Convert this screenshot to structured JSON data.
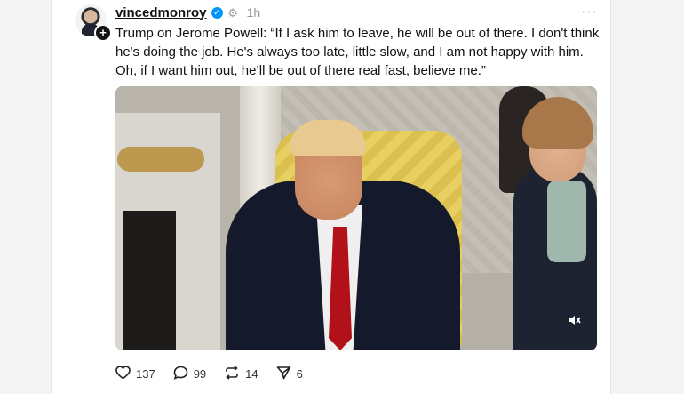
{
  "post": {
    "username": "vincedmonroy",
    "timestamp": "1h",
    "text": "Trump on Jerome Powell⁠⁦: “If I ask him to leave, he will be out of there. I don't think he's doing the job. He's always too late, little slow, and I am not happy with him. Oh, if I want him out, he’ll be out of there real fast, believe me.”",
    "follow_symbol": "+",
    "more_symbol": "···"
  },
  "actions": {
    "likes": "137",
    "comments": "99",
    "reposts": "14",
    "shares": "6"
  },
  "icons": {
    "verified": "verified-badge-icon",
    "gear": "settings-icon",
    "like": "heart-icon",
    "comment": "comment-bubble-icon",
    "repost": "repost-icon",
    "share": "share-icon",
    "mute": "muted-speaker-icon"
  },
  "colors": {
    "verified": "#0095f6",
    "tie": "#b3111a",
    "chair": "#e7cf62"
  }
}
